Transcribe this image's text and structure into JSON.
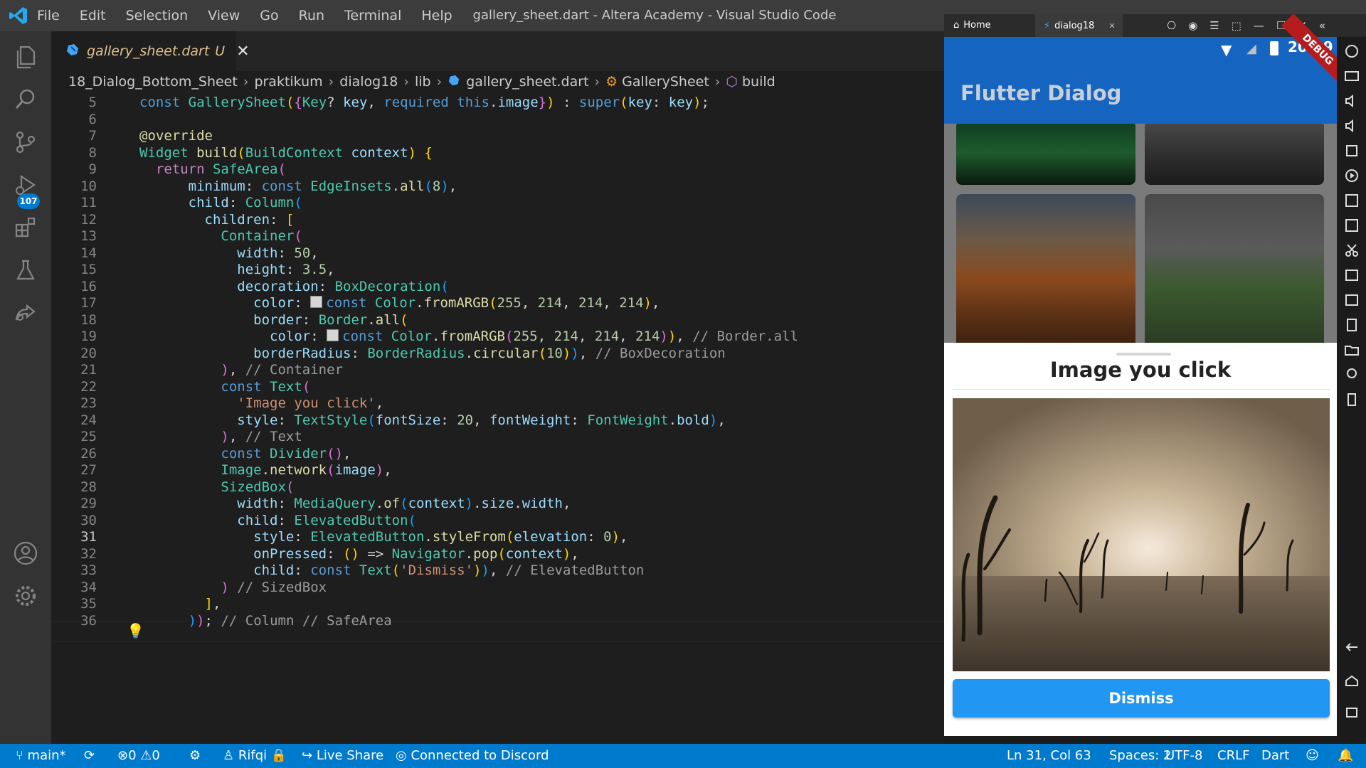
{
  "app": {
    "window_title": "gallery_sheet.dart - Altera Academy - Visual Studio Code",
    "menu": [
      "File",
      "Edit",
      "Selection",
      "View",
      "Go",
      "Run",
      "Terminal",
      "Help"
    ]
  },
  "activity_bar": {
    "scm_badge": "107",
    "icons": [
      "explorer-icon",
      "search-icon",
      "source-control-icon",
      "run-debug-icon",
      "extensions-icon",
      "testing-icon",
      "live-share-icon",
      "account-icon",
      "manage-gear-icon"
    ]
  },
  "tab": {
    "name": "gallery_sheet.dart",
    "status": "U",
    "close": "✕"
  },
  "breadcrumb": [
    "18_Dialog_Bottom_Sheet",
    "praktikum",
    "dialog18",
    "lib",
    "gallery_sheet.dart",
    "GallerySheet",
    "build"
  ],
  "editor": {
    "current_line": 31,
    "lines": [
      {
        "n": "5"
      },
      {
        "n": "6"
      },
      {
        "n": "7"
      },
      {
        "n": "8"
      },
      {
        "n": "9"
      },
      {
        "n": "10"
      },
      {
        "n": "11"
      },
      {
        "n": "12"
      },
      {
        "n": "13"
      },
      {
        "n": "14"
      },
      {
        "n": "15"
      },
      {
        "n": "16"
      },
      {
        "n": "17"
      },
      {
        "n": "18"
      },
      {
        "n": "19"
      },
      {
        "n": "20"
      },
      {
        "n": "21"
      },
      {
        "n": "22"
      },
      {
        "n": "23"
      },
      {
        "n": "24"
      },
      {
        "n": "25"
      },
      {
        "n": "26"
      },
      {
        "n": "27"
      },
      {
        "n": "28"
      },
      {
        "n": "29"
      },
      {
        "n": "30"
      },
      {
        "n": "31"
      },
      {
        "n": "32"
      },
      {
        "n": "33"
      },
      {
        "n": "34"
      },
      {
        "n": "35"
      },
      {
        "n": "36"
      }
    ]
  },
  "status_bar": {
    "branch": "main*",
    "errors": "0",
    "warnings": "0",
    "user": "Rifqi",
    "live_share": "Live Share",
    "discord": "Connected to Discord",
    "position": "Ln 31, Col 63",
    "spaces": "Spaces: 2",
    "encoding": "UTF-8",
    "eol": "CRLF",
    "language": "Dart"
  },
  "emulator": {
    "tab_home": "Home",
    "tab_app": "dialog18",
    "tab_close": "✕",
    "clock": "20:29",
    "debug_banner": "DEBUG",
    "app_title": "Flutter Dialog",
    "sheet_title": "Image you click",
    "dismiss_label": "Dismiss"
  },
  "colors": {
    "statusbar": "#007acc",
    "appbar": "#1565c0",
    "button": "#2196f3",
    "modified": "#e2c08d"
  }
}
